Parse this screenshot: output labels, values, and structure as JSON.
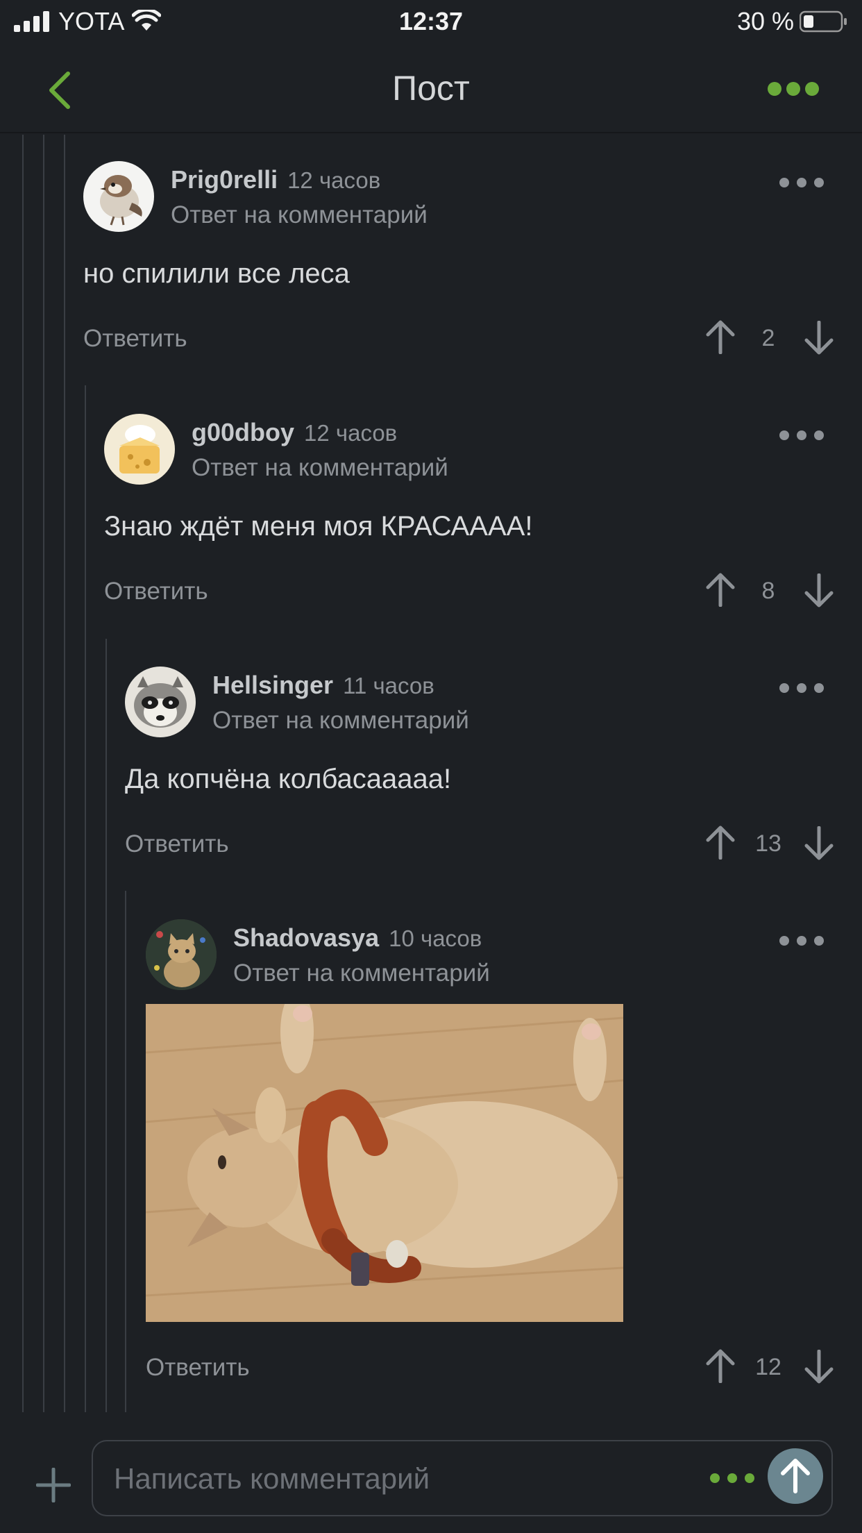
{
  "status": {
    "carrier": "YOTA",
    "time": "12:37",
    "battery": "30 %"
  },
  "nav": {
    "title": "Пост"
  },
  "colors": {
    "accent": "#6aaa3a",
    "background": "#1d2024",
    "muted": "#8e9297",
    "send": "#6b8690"
  },
  "comments": [
    {
      "username": "Prig0relli",
      "time": "12 часов",
      "reply_to": "Ответ на комментарий",
      "text": "но спилили все леса",
      "reply": "Ответить",
      "score": "2",
      "avatar": "sparrow-avatar"
    },
    {
      "username": "g00dboy",
      "time": "12 часов",
      "reply_to": "Ответ на комментарий",
      "text": "Знаю ждёт меня моя КРАСАААА!",
      "reply": "Ответить",
      "score": "8",
      "avatar": "cheese-avatar"
    },
    {
      "username": "Hellsinger",
      "time": "11 часов",
      "reply_to": "Ответ на комментарий",
      "text": "Да копчёна колбасааааа!",
      "reply": "Ответить",
      "score": "13",
      "avatar": "raccoon-avatar"
    },
    {
      "username": "Shadovasya",
      "time": "10 часов",
      "reply_to": "Ответ на комментарий",
      "text": "",
      "reply": "Ответить",
      "score": "12",
      "avatar": "cat-avatar",
      "image": "cat-with-sausage-photo"
    }
  ],
  "composer": {
    "placeholder": "Написать комментарий"
  }
}
